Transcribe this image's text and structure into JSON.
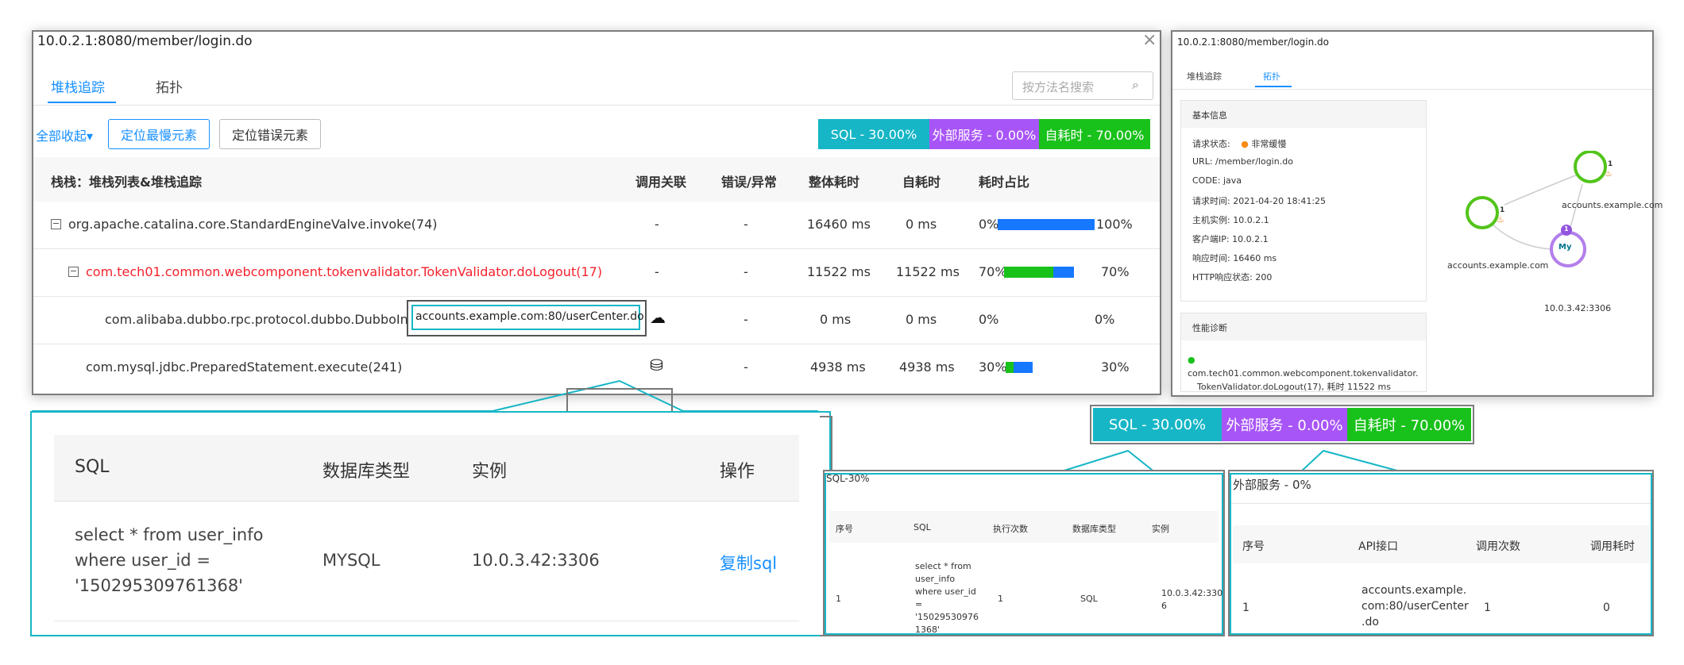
{
  "main": {
    "url": "10.0.2.1:8080/member/login.do",
    "tabs": [
      {
        "label": "堆栈追踪"
      },
      {
        "label": "拓扑"
      }
    ],
    "search_placeholder": "按方法名搜索",
    "collapse_all": "全部收起",
    "locate_slowest": "定位最慢元素",
    "locate_error": "定位错误元素",
    "badges": {
      "sql": "SQL - 30.00%",
      "external": "外部服务 - 0.00%",
      "self": "自耗时 - 70.00%"
    },
    "headers": {
      "stack": "栈栈：堆栈列表&堆栈追踪",
      "call": "调用关联",
      "error": "错误/异常",
      "total": "整体耗时",
      "self": "自耗时",
      "ratio": "耗时占比"
    },
    "rows": [
      {
        "method": "org.apache.catalina.core.StandardEngineValve.invoke(74)",
        "call": "-",
        "error": "-",
        "total": "16460 ms",
        "self": "0 ms",
        "pct_left": "0%",
        "pct_right": "100%",
        "green": 0,
        "blue": 1.0
      },
      {
        "method": "com.tech01.common.webcomponent.tokenvalidator.TokenValidator.doLogout(17)",
        "call": "-",
        "error": "-",
        "total": "11522 ms",
        "self": "11522 ms",
        "pct_left": "70%",
        "pct_right": "70%",
        "green": 0.7,
        "blue": 0.3
      },
      {
        "method": "com.alibaba.dubbo.rpc.protocol.dubbo.DubboInvoker.do",
        "call": "",
        "error": "-",
        "total": "0 ms",
        "self": "0 ms",
        "pct_left": "0%",
        "pct_right": "0%",
        "green": 0,
        "blue": 0
      },
      {
        "method": "com.mysql.jdbc.PreparedStatement.execute(241)",
        "call": "",
        "error": "-",
        "total": "4938 ms",
        "self": "4938 ms",
        "pct_left": "30%",
        "pct_right": "30%",
        "green": 0.09,
        "blue": 0.21
      }
    ],
    "tooltip": "accounts.example.com:80/userCenter.do"
  },
  "sql_popup": {
    "headers": {
      "sql": "SQL",
      "db": "数据库类型",
      "instance": "实例",
      "op": "操作"
    },
    "sql_lines": [
      "select * from user_info",
      "where user_id =",
      "'150295309761368'"
    ],
    "db": "MYSQL",
    "instance": "10.0.3.42:3306",
    "copy": "复制sql"
  },
  "topo": {
    "url": "10.0.2.1:8080/member/login.do",
    "tabs": [
      {
        "label": "堆栈追踪"
      },
      {
        "label": "拓扑"
      }
    ],
    "basic_title": "基本信息",
    "fields": [
      {
        "label": "请求状态:",
        "value": "非常缓慢"
      },
      {
        "label": "URL:",
        "value": "/member/login.do"
      },
      {
        "label": "CODE:",
        "value": "java"
      },
      {
        "label": "请求时间:",
        "value": "2021-04-20 18:41:25"
      },
      {
        "label": "主机实例:",
        "value": "10.0.2.1"
      },
      {
        "label": "客户端IP:",
        "value": "10.0.2.1"
      },
      {
        "label": "响应时间:",
        "value": "16460 ms"
      },
      {
        "label": "HTTP响应状态:",
        "value": "200"
      }
    ],
    "perf_title": "性能诊断",
    "perf_lines": [
      "com.tech01.common.webcomponent.tokenvalidator.",
      "TokenValidator.doLogout(17), 耗时 11522 ms"
    ],
    "nodes": {
      "node_a": "accounts.example.com",
      "node_b": "accounts.example.com",
      "db": "10.0.3.42:3306",
      "count": "1"
    }
  },
  "badges2": {
    "sql": "SQL - 30.00%",
    "external": "外部服务 - 0.00%",
    "self": "自耗时 - 70.00%"
  },
  "sql30": {
    "title": "SQL-30%",
    "headers": {
      "no": "序号",
      "sql": "SQL",
      "count": "执行次数",
      "db": "数据库类型",
      "instance": "实例"
    },
    "row": {
      "no": "1",
      "sql_lines": [
        "select * from",
        "user_info",
        "where user_id",
        "=",
        "'15029530976",
        "1368'"
      ],
      "count": "1",
      "db": "SQL",
      "instance_lines": [
        "10.0.3.42:330",
        "6"
      ]
    }
  },
  "ext": {
    "title": "外部服务 - 0%",
    "headers": {
      "no": "序号",
      "api": "API接口",
      "count": "调用次数",
      "time": "调用耗时"
    },
    "row": {
      "no": "1",
      "api_lines": [
        "accounts.example.",
        "com:80/userCenter",
        ".do"
      ],
      "count": "1",
      "time": "0"
    }
  },
  "colors": {
    "accent": "#1890ff",
    "cyan": "#16b6c6",
    "purple": "#a855f7",
    "green": "#19c11b",
    "red": "#f5222d",
    "bar_blue": "#1677ff"
  }
}
